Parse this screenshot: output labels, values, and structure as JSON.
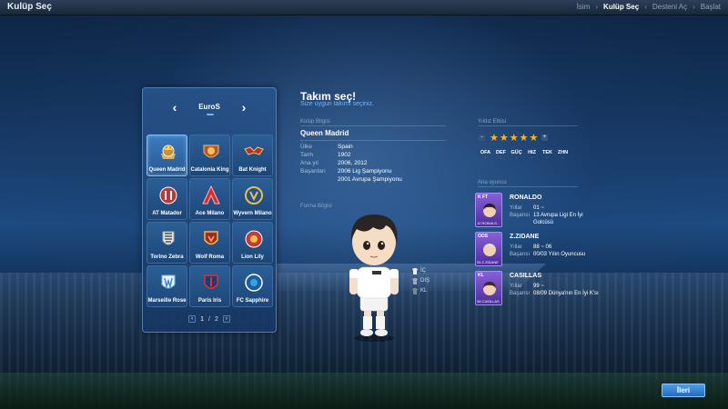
{
  "topbar": {
    "title": "Kulüp Seç",
    "breadcrumbs": [
      "İsim",
      "Kulüp Seç",
      "Desteni Aç",
      "Başlat"
    ],
    "active_index": 1
  },
  "club_panel": {
    "league": "EuroS",
    "clubs": [
      {
        "name": "Queen Madrid",
        "selected": true
      },
      {
        "name": "Catalonia King"
      },
      {
        "name": "Bat Knight"
      },
      {
        "name": "AT Matador"
      },
      {
        "name": "Ace Milano"
      },
      {
        "name": "Wyvern Milano"
      },
      {
        "name": "Torino Zebra"
      },
      {
        "name": "Wolf Roma"
      },
      {
        "name": "Lion Lily"
      },
      {
        "name": "Marseille Rose"
      },
      {
        "name": "Paris Iris"
      },
      {
        "name": "FC Sapphire"
      }
    ],
    "page_current": "1",
    "page_sep": "/",
    "page_total": "2"
  },
  "main": {
    "heading": "Takım seç!",
    "subheading": "Size uygun takımı seçiniz.",
    "club_info_label": "Kulüp Bilgisi",
    "club_name": "Queen Madrid",
    "rows": [
      {
        "k": "Ülke",
        "v": "Spain"
      },
      {
        "k": "Tarih",
        "v": "1902"
      },
      {
        "k": "Ana yıl",
        "v": "2006, 2012"
      },
      {
        "k": "Başarıları",
        "v": "2006 Lig Şampiyonu"
      },
      {
        "k": "",
        "v": "2001 Avrupa  Şampiyonu"
      }
    ],
    "kit_label": "Forma Bilgisi",
    "kit_options": [
      "İÇ",
      "DIŞ",
      "KL"
    ]
  },
  "right": {
    "stars_label": "Yıldız Etkisi",
    "stars": 5,
    "stat_keys": [
      "OFA",
      "DEF",
      "GÜÇ",
      "HIZ",
      "TEK",
      "ZHN"
    ],
    "stat_values": [
      "-",
      "-",
      "-",
      "-",
      "-",
      "-"
    ],
    "players_label": "Ana oyuncu",
    "players": [
      {
        "pos": "K FT",
        "cap": "10 RONALD...",
        "name": "RONALDO",
        "years_k": "Yıllar",
        "years": "01 ~",
        "ach_k": "Başarısı",
        "ach": "13 Avrupa Ligi En İyi",
        "ach2": "Golcüsü"
      },
      {
        "pos": "OOS",
        "cap": "05 Z.ZIDANE",
        "name": "Z.ZIDANE",
        "years_k": "Yıllar",
        "years": "88 ~ 06",
        "ach_k": "Başarısı",
        "ach": "00/03 Yılın Oyuncusu",
        "ach2": ""
      },
      {
        "pos": "KL",
        "cap": "08 CASILLAS",
        "name": "CASILLAS",
        "years_k": "Yıllar",
        "years": "99 ~",
        "ach_k": "Başarısı",
        "ach": "08/09 Dünya'nın En İyi K'sı",
        "ach2": ""
      }
    ]
  },
  "next_button": "İleri",
  "colors": {
    "accent": "#6fb6ff",
    "star": "#ffb318",
    "stat_value": "#ff4040",
    "button": "#2f7fd0"
  }
}
